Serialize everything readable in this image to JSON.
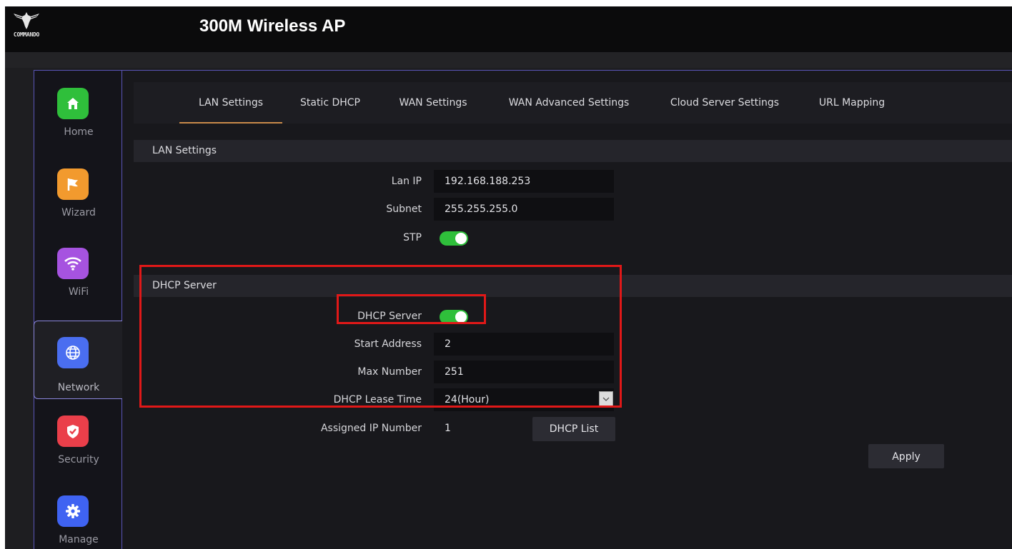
{
  "app": {
    "logo_text": "COMMANDO",
    "title": "300M Wireless AP"
  },
  "sidebar": {
    "items": [
      {
        "label": "Home",
        "color": "#2fbf3b",
        "icon": "home-icon"
      },
      {
        "label": "Wizard",
        "color": "#f29a2e",
        "icon": "flag-icon"
      },
      {
        "label": "WiFi",
        "color": "#a653e0",
        "icon": "wifi-icon"
      },
      {
        "label": "Network",
        "color": "#4a6ef0",
        "icon": "globe-icon",
        "active": true
      },
      {
        "label": "Security",
        "color": "#ea3f4a",
        "icon": "shield-icon"
      },
      {
        "label": "Manage",
        "color": "#3f63f2",
        "icon": "gear-icon"
      }
    ]
  },
  "tabs": [
    {
      "label": "LAN Settings",
      "active": true
    },
    {
      "label": "Static DHCP"
    },
    {
      "label": "WAN Settings"
    },
    {
      "label": "WAN Advanced Settings"
    },
    {
      "label": "Cloud Server Settings"
    },
    {
      "label": "URL Mapping"
    }
  ],
  "lan": {
    "section_title": "LAN Settings",
    "lan_ip_label": "Lan IP",
    "lan_ip_value": "192.168.188.253",
    "subnet_label": "Subnet",
    "subnet_value": "255.255.255.0",
    "stp_label": "STP",
    "stp_enabled": true
  },
  "dhcp": {
    "section_title": "DHCP Server",
    "server_label": "DHCP Server",
    "server_enabled": true,
    "start_label": "Start Address",
    "start_value": "2",
    "max_label": "Max Number",
    "max_value": "251",
    "lease_label": "DHCP Lease Time",
    "lease_value": "24(Hour)",
    "assigned_label": "Assigned IP Number",
    "assigned_value": "1",
    "list_button": "DHCP List"
  },
  "apply_button": "Apply",
  "colors": {
    "toggle_on": "#2fbf3b",
    "tab_active_underline": "#c98a4a",
    "highlight": "#e01818",
    "sidebar_border": "#5a55b8"
  }
}
